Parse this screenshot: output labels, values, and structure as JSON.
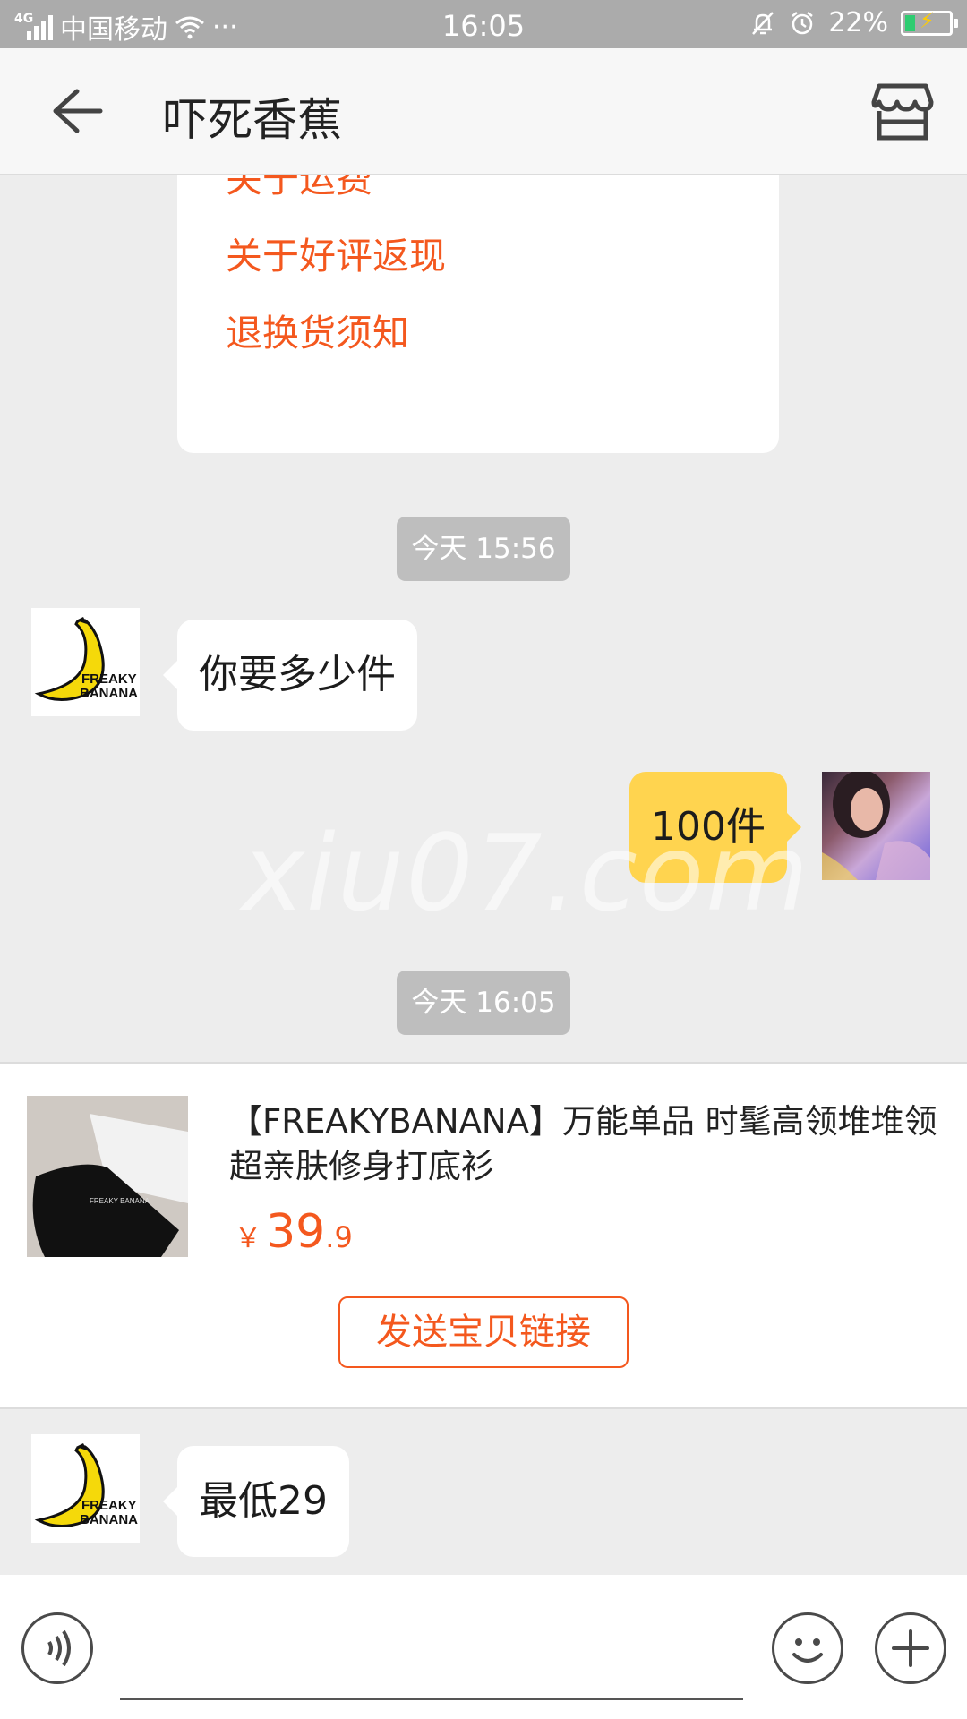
{
  "status_bar": {
    "network": "4G",
    "carrier": "中国移动",
    "more": "···",
    "time": "16:05",
    "battery": "22%",
    "battery_level": 0.22
  },
  "header": {
    "title": "吓死香蕉",
    "back_icon": "arrow-left-icon",
    "shop_icon": "store-icon"
  },
  "faq": {
    "links": [
      "关于运费",
      "关于好评返现",
      "退换货须知"
    ]
  },
  "messages": {
    "time_1": "今天 15:56",
    "seller_msg_1": "你要多少件",
    "user_msg_1": "100件",
    "time_2": "今天 16:05",
    "seller_msg_2": "最低29"
  },
  "product": {
    "title": "【FREAKYBANANA】万能单品 时髦高领堆堆领超亲肤修身打底衫",
    "price_symbol": "￥",
    "price_int": "39",
    "price_dec": ".9",
    "send_button": "发送宝贝链接",
    "thumb_text": "FREAKY BANANA"
  },
  "avatar": {
    "brand_line1": "FREAKY",
    "brand_line2": "BANANA"
  },
  "watermark": "xiu07.com",
  "input_bar": {
    "placeholder": "",
    "voice_icon": "voice-icon",
    "emoji_icon": "smiley-icon",
    "plus_icon": "plus-icon"
  },
  "colors": {
    "accent": "#f4581e",
    "user_bubble": "#ffd44f",
    "background": "#ededed"
  }
}
